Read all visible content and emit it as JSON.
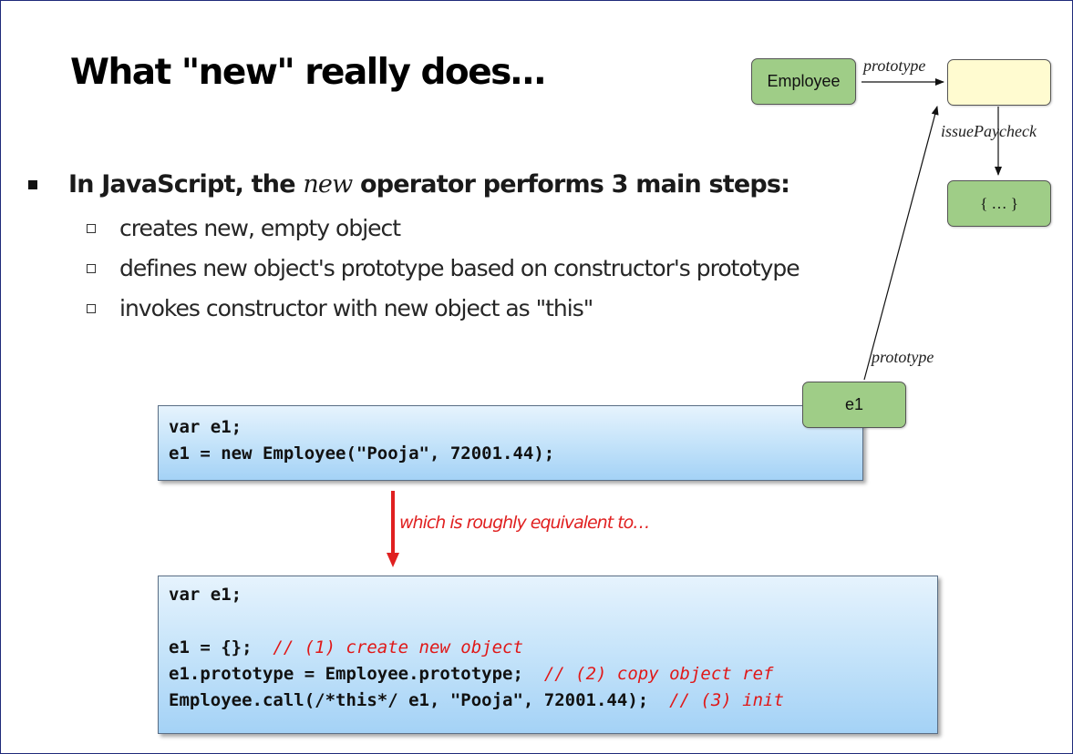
{
  "slide": {
    "title": "What \"new\" really does…",
    "bullet": {
      "prefix": "In JavaScript, the ",
      "emphasis": "new",
      "suffix": " operator performs 3 main steps:"
    },
    "sub_items": [
      "creates new, empty object",
      "defines new object's prototype based on constructor's prototype",
      "invokes constructor with new object as \"this\""
    ],
    "code_block_1": [
      "var e1;",
      "e1 = new Employee(\"Pooja\", 72001.44);"
    ],
    "annotation": "which is roughly equivalent to…",
    "code_block_2": {
      "line1": "var e1;",
      "line3_code": "e1 = {};  ",
      "line3_comment": "// (1) create new object",
      "line4_code": "e1.prototype = Employee.prototype;  ",
      "line4_comment": "// (2) copy object ref",
      "line5_code": "Employee.call(/*this*/ e1, \"Pooja\", 72001.44);  ",
      "line5_comment": "// (3) init"
    }
  },
  "diagram": {
    "employee_label": "Employee",
    "prototype_label_top": "prototype",
    "issue_paycheck_label": "issuePaycheck",
    "function_body_label": "{ … }",
    "e1_label": "e1",
    "prototype_label_side": "prototype"
  },
  "colors": {
    "node_green": "#9fcd87",
    "node_cream": "#fffbd0",
    "comment_red": "#e01818",
    "arrow_red": "#e02020"
  }
}
